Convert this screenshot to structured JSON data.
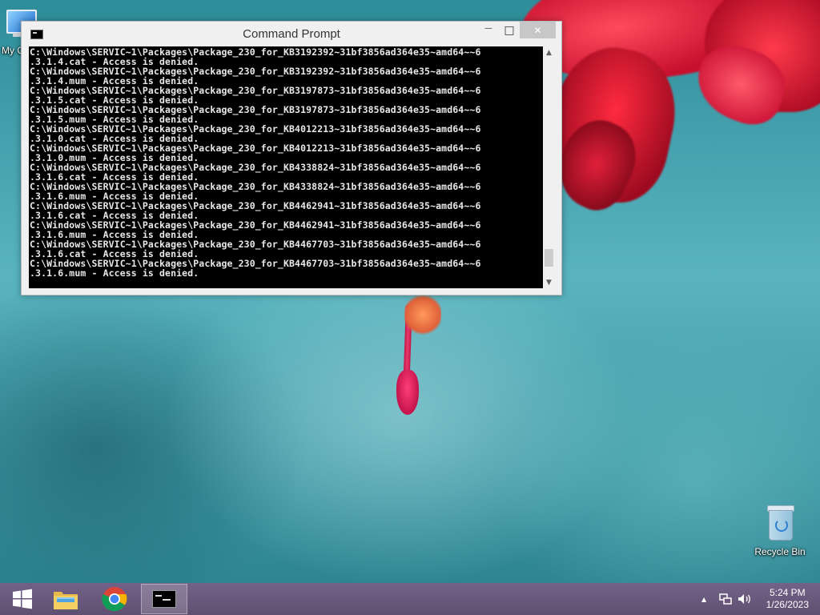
{
  "desktop": {
    "icons": [
      {
        "label": "My C"
      },
      {
        "label": "Recycle Bin"
      }
    ]
  },
  "window": {
    "title": "Command Prompt",
    "console_lines": [
      "C:\\Windows\\SERVIC~1\\Packages\\Package_230_for_KB3192392~31bf3856ad364e35~amd64~~6",
      ".3.1.4.cat - Access is denied.",
      "C:\\Windows\\SERVIC~1\\Packages\\Package_230_for_KB3192392~31bf3856ad364e35~amd64~~6",
      ".3.1.4.mum - Access is denied.",
      "C:\\Windows\\SERVIC~1\\Packages\\Package_230_for_KB3197873~31bf3856ad364e35~amd64~~6",
      ".3.1.5.cat - Access is denied.",
      "C:\\Windows\\SERVIC~1\\Packages\\Package_230_for_KB3197873~31bf3856ad364e35~amd64~~6",
      ".3.1.5.mum - Access is denied.",
      "C:\\Windows\\SERVIC~1\\Packages\\Package_230_for_KB4012213~31bf3856ad364e35~amd64~~6",
      ".3.1.0.cat - Access is denied.",
      "C:\\Windows\\SERVIC~1\\Packages\\Package_230_for_KB4012213~31bf3856ad364e35~amd64~~6",
      ".3.1.0.mum - Access is denied.",
      "C:\\Windows\\SERVIC~1\\Packages\\Package_230_for_KB4338824~31bf3856ad364e35~amd64~~6",
      ".3.1.6.cat - Access is denied.",
      "C:\\Windows\\SERVIC~1\\Packages\\Package_230_for_KB4338824~31bf3856ad364e35~amd64~~6",
      ".3.1.6.mum - Access is denied.",
      "C:\\Windows\\SERVIC~1\\Packages\\Package_230_for_KB4462941~31bf3856ad364e35~amd64~~6",
      ".3.1.6.cat - Access is denied.",
      "C:\\Windows\\SERVIC~1\\Packages\\Package_230_for_KB4462941~31bf3856ad364e35~amd64~~6",
      ".3.1.6.mum - Access is denied.",
      "C:\\Windows\\SERVIC~1\\Packages\\Package_230_for_KB4467703~31bf3856ad364e35~amd64~~6",
      ".3.1.6.cat - Access is denied.",
      "C:\\Windows\\SERVIC~1\\Packages\\Package_230_for_KB4467703~31bf3856ad364e35~amd64~~6",
      ".3.1.6.mum - Access is denied."
    ],
    "buttons": {
      "minimize": "—",
      "maximize": "□",
      "close": "✕"
    },
    "scroll": {
      "up": "▲",
      "down": "▼",
      "position": 0.95
    }
  },
  "taskbar": {
    "items": [
      {
        "icon": "windows-start-icon"
      },
      {
        "icon": "file-explorer-icon"
      },
      {
        "icon": "chrome-icon"
      },
      {
        "icon": "command-prompt-icon",
        "active": true
      }
    ],
    "tray": {
      "show_hidden": "▲",
      "network": "network-icon",
      "volume": "volume-icon"
    },
    "clock": {
      "time": "5:24 PM",
      "date": "1/26/2023"
    }
  },
  "colors": {
    "console_bg": "#000000",
    "console_text": "#e8e8e8",
    "taskbar": "#6e567d",
    "desktop": "#4fa9b4"
  }
}
